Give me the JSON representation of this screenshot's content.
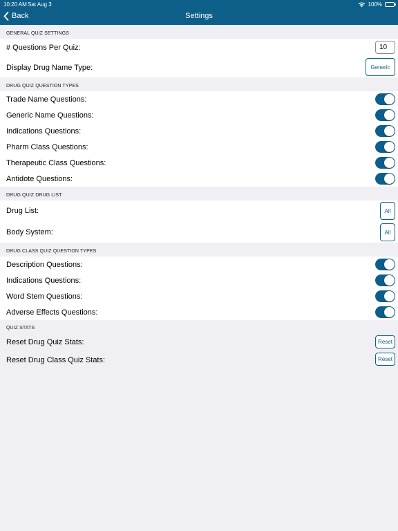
{
  "status_bar": {
    "time": "10:20 AM",
    "date": "Sat Aug 3",
    "battery": "100%"
  },
  "nav": {
    "back_label": "Back",
    "title": "Settings"
  },
  "general": {
    "header": "GENERAL QUIZ SETTINGS",
    "questions_per_quiz_label": "# Questions Per Quiz:",
    "questions_per_quiz_value": "10",
    "drug_name_type_label": "Display Drug Name Type:",
    "drug_name_type_value": "Generic"
  },
  "drug_quiz_types": {
    "header": "DRUG QUIZ QUESTION TYPES",
    "items": [
      {
        "label": "Trade Name Questions:",
        "on": true
      },
      {
        "label": "Generic Name Questions:",
        "on": true
      },
      {
        "label": "Indications Questions:",
        "on": true
      },
      {
        "label": "Pharm Class Questions:",
        "on": true
      },
      {
        "label": "Therapeutic Class Questions:",
        "on": true
      },
      {
        "label": "Antidote Questions:",
        "on": true
      }
    ]
  },
  "drug_list": {
    "header": "DRUG QUIZ DRUG LIST",
    "drug_list_label": "Drug List:",
    "drug_list_value": "All",
    "body_system_label": "Body System:",
    "body_system_value": "All"
  },
  "drug_class_types": {
    "header": "DRUG CLASS QUIZ QUESTION TYPES",
    "items": [
      {
        "label": "Description Questions:",
        "on": true
      },
      {
        "label": "Indications Questions:",
        "on": true
      },
      {
        "label": "Word Stem Questions:",
        "on": true
      },
      {
        "label": "Adverse Effects Questions:",
        "on": true
      }
    ]
  },
  "quiz_stats": {
    "header": "QUIZ STATS",
    "reset_drug_label": "Reset Drug Quiz Stats:",
    "reset_drug_button": "Reset",
    "reset_class_label": "Reset Drug Class Quiz Stats:",
    "reset_class_button": "Reset"
  },
  "colors": {
    "accent": "#0d5f8a",
    "background": "#efeff4"
  }
}
